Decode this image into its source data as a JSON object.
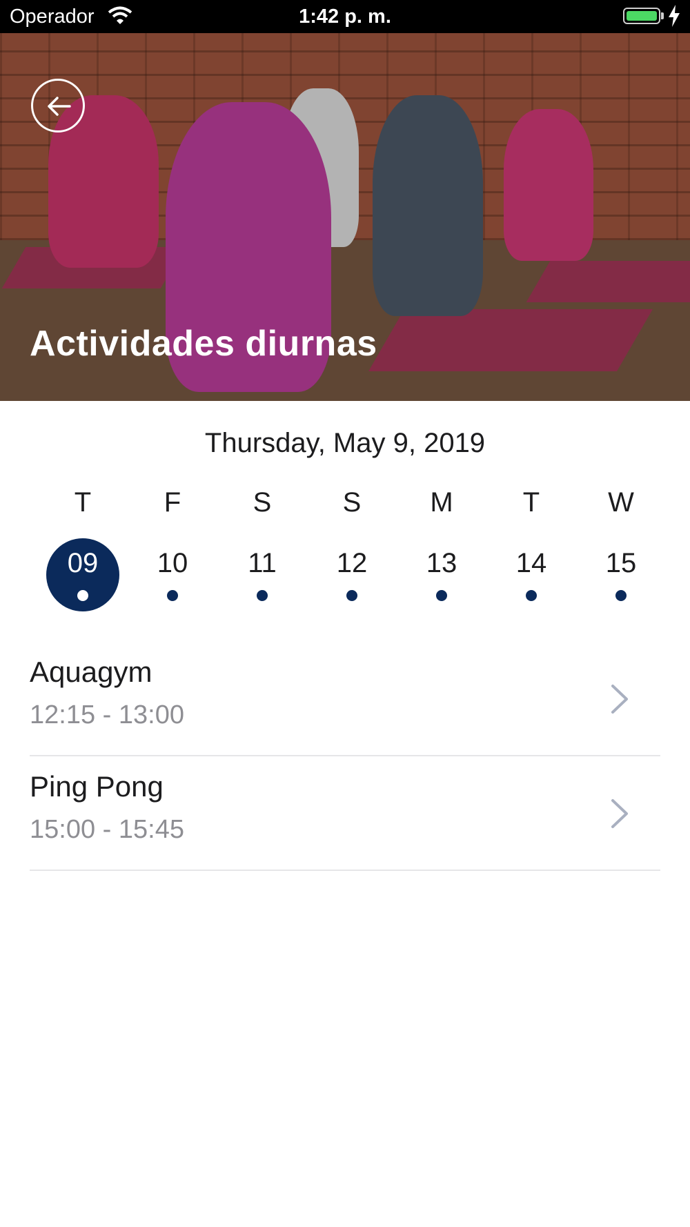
{
  "status_bar": {
    "carrier": "Operador",
    "time": "1:42 p. m.",
    "battery_level": 1.0,
    "icons": [
      "wifi-icon",
      "battery-icon",
      "charging-bolt-icon"
    ]
  },
  "hero": {
    "title": "Actividades diurnas",
    "back_icon": "arrow-left-icon"
  },
  "calendar": {
    "header": "Thursday, May 9, 2019",
    "selected_index": 0,
    "accent_color": "#0b2a5b",
    "days": [
      {
        "letter": "T",
        "number": "09"
      },
      {
        "letter": "F",
        "number": "10"
      },
      {
        "letter": "S",
        "number": "11"
      },
      {
        "letter": "S",
        "number": "12"
      },
      {
        "letter": "M",
        "number": "13"
      },
      {
        "letter": "T",
        "number": "14"
      },
      {
        "letter": "W",
        "number": "15"
      }
    ]
  },
  "activities": [
    {
      "name": "Aquagym",
      "time": "12:15 - 13:00",
      "icon": "chevron-right-icon"
    },
    {
      "name": "Ping Pong",
      "time": "15:00 - 15:45",
      "icon": "chevron-right-icon"
    }
  ]
}
